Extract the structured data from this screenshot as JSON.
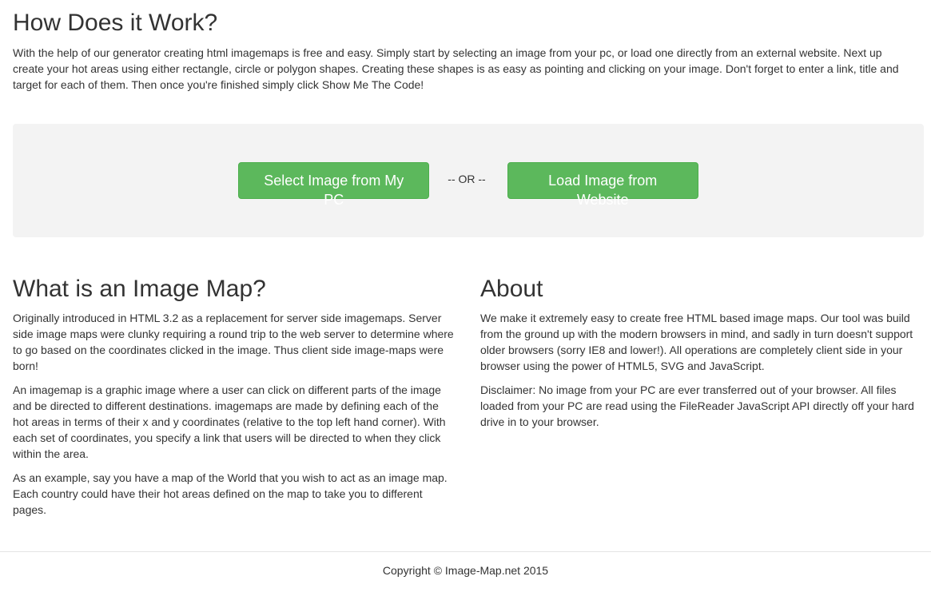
{
  "how_it_works": {
    "heading": "How Does it Work?",
    "text": "With the help of our generator creating html imagemaps is free and easy. Simply start by selecting an image from your pc, or load one directly from an external website. Next up create your hot areas using either rectangle, circle or polygon shapes. Creating these shapes is as easy as pointing and clicking on your image. Don't forget to enter a link, title and target for each of them. Then once you're finished simply click Show Me The Code!"
  },
  "actions": {
    "select_pc_label": "Select Image from My PC",
    "or_label": "-- OR --",
    "load_web_label": "Load Image from Website"
  },
  "what_is": {
    "heading": "What is an Image Map?",
    "paragraphs": [
      "Originally introduced in HTML 3.2 as a replacement for server side imagemaps. Server side image maps were clunky requiring a round trip to the web server to determine where to go based on the coordinates clicked in the image. Thus client side image-maps were born!",
      "An imagemap is a graphic image where a user can click on different parts of the image and be directed to different destinations. imagemaps are made by defining each of the hot areas in terms of their x and y coordinates (relative to the top left hand corner). With each set of coordinates, you specify a link that users will be directed to when they click within the area.",
      "As an example, say you have a map of the World that you wish to act as an image map. Each country could have their hot areas defined on the map to take you to different pages."
    ]
  },
  "about": {
    "heading": "About",
    "paragraphs": [
      "We make it extremely easy to create free HTML based image maps. Our tool was build from the ground up with the modern browsers in mind, and sadly in turn doesn't support older browsers (sorry IE8 and lower!). All operations are completely client side in your browser using the power of HTML5, SVG and JavaScript.",
      "Disclaimer: No image from your PC are ever transferred out of your browser. All files loaded from your PC are read using the FileReader JavaScript API directly off your hard drive in to your browser."
    ]
  },
  "footer": {
    "copyright": "Copyright © Image-Map.net 2015"
  },
  "colors": {
    "button_green": "#5cb85c",
    "well_background": "#f3f3f3",
    "text": "#333333"
  }
}
